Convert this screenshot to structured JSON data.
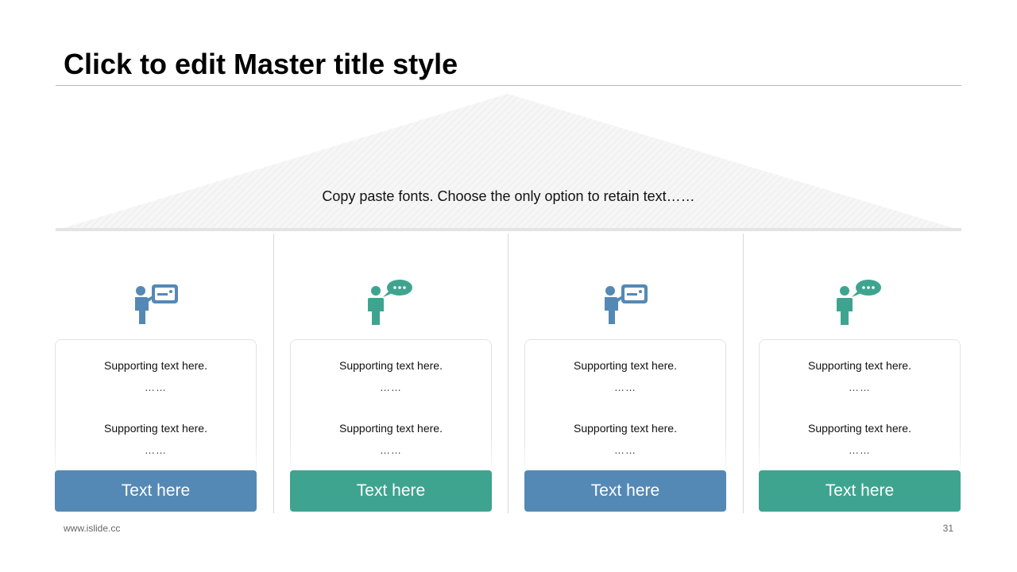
{
  "slide": {
    "title": "Click to edit Master title style",
    "roof_text": "Copy paste fonts. Choose the only option to retain text……",
    "footer_url": "www.islide.cc",
    "page_number": "31"
  },
  "colors": {
    "blue": "#5589b5",
    "green": "#3fa48f"
  },
  "columns": [
    {
      "icon": "presenter-board-icon",
      "line1": "Supporting text here.",
      "dots1": "……",
      "line2": "Supporting text here.",
      "dots2": "……",
      "button_label": "Text here",
      "color": "#5589b5"
    },
    {
      "icon": "person-speech-bubble-icon",
      "line1": "Supporting text here.",
      "dots1": "……",
      "line2": "Supporting text here.",
      "dots2": "……",
      "button_label": "Text here",
      "color": "#3fa48f"
    },
    {
      "icon": "presenter-board-icon",
      "line1": "Supporting text here.",
      "dots1": "……",
      "line2": "Supporting text here.",
      "dots2": "……",
      "button_label": "Text here",
      "color": "#5589b5"
    },
    {
      "icon": "person-speech-bubble-icon",
      "line1": "Supporting text here.",
      "dots1": "……",
      "line2": "Supporting text here.",
      "dots2": "……",
      "button_label": "Text here",
      "color": "#3fa48f"
    }
  ]
}
